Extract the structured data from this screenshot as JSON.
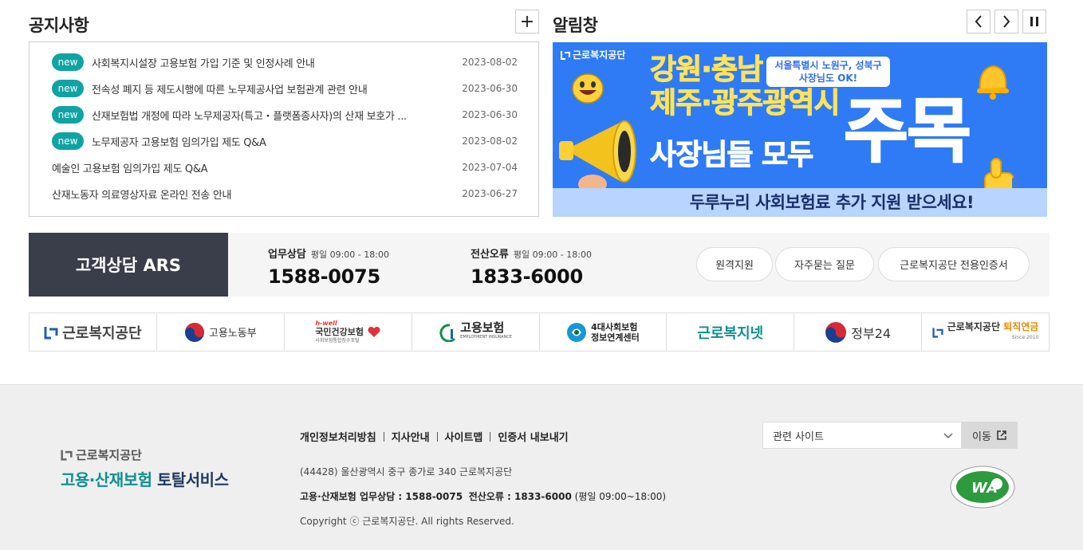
{
  "notice": {
    "title": "공지사항",
    "more_label": "+",
    "items": [
      {
        "badge": "new",
        "text": "사회복지시설장 고용보험 가입 기준 및 인정사례 안내",
        "date": "2023-08-02"
      },
      {
        "badge": "new",
        "text": "전속성 폐지 등 제도시행에 따른 노무제공사업 보험관계 관련 안내",
        "date": "2023-06-30"
      },
      {
        "badge": "new",
        "text": "산재보험법 개정에 따라 노무제공자(특고・플랫폼종사자)의 산재 보호가 ...",
        "date": "2023-06-30"
      },
      {
        "badge": "new",
        "text": "노무제공자 고용보험 임의가입 제도 Q&A",
        "date": "2023-08-02"
      },
      {
        "badge": "",
        "text": "예술인 고용보험 임의가입 제도 Q&A",
        "date": "2023-07-04"
      },
      {
        "badge": "",
        "text": "산재노동자 의료영상자료 온라인 전송 안내",
        "date": "2023-06-27"
      }
    ]
  },
  "alert": {
    "title": "알림창",
    "banner": {
      "logo": "근로복지공단",
      "line1": "강원·충남",
      "line2": "제주·광주광역시",
      "line3": "사장님들 모두",
      "big": "주목",
      "bubble_line1": "서울특별시 노원구, 성북구",
      "bubble_line2": "사장님도 OK!",
      "bottom": "두루누리 사회보험료 추가 지원 받으세요!"
    }
  },
  "ars": {
    "title": "고객상담 ARS",
    "items": [
      {
        "label": "업무상담",
        "hours": "평일 09:00 - 18:00",
        "number": "1588-0075"
      },
      {
        "label": "전산오류",
        "hours": "평일 09:00 - 18:00",
        "number": "1833-6000"
      }
    ],
    "buttons": [
      "원격지원",
      "자주묻는 질문",
      "근로복지공단 전용인증서"
    ]
  },
  "partners": [
    {
      "name": "근로복지공단",
      "icon": "kcomwel-logo-icon"
    },
    {
      "name": "고용노동부",
      "icon": "taegeuk-icon"
    },
    {
      "name": "국민건강보험",
      "sub": "사회보험통합징수포털",
      "tag": "h-well",
      "icon": "heart-icon"
    },
    {
      "name": "고용보험",
      "sub": "EMPLOYMENT INSURANCE",
      "icon": "ei-logo-icon"
    },
    {
      "name": "4대사회보험",
      "sub": "정보연계센터",
      "icon": "4insure-logo-icon"
    },
    {
      "name": "근로복지넷",
      "icon": ""
    },
    {
      "name": "정부24",
      "icon": "taegeuk-icon"
    },
    {
      "name": "근로복지공단",
      "accent": "퇴직연금",
      "sub": "Since 2010",
      "icon": "kcomwel-logo-icon"
    }
  ],
  "footer": {
    "logo_small": "근로복지공단",
    "logo_big_accent": "고용·산재보험",
    "logo_big_rest": "토탈서비스",
    "links": [
      "개인정보처리방침",
      "지사안내",
      "사이트맵",
      "인증서 내보내기"
    ],
    "address": "(44428) 울산광역시 중구 종가로 340 근로복지공단",
    "phone_label1": "고용·산재보험 업무상담 : 1588-0075",
    "phone_label2": "전산오류 : 1833-6000",
    "phone_hours": "(평일 09:00~18:00)",
    "copyright": "Copyright ⓒ 근로복지공단. All rights Reserved.",
    "related_site_select": "관련 사이트",
    "go_button": "이동",
    "wa_label": "WA"
  },
  "colors": {
    "teal_badge": "#10a3a3",
    "banner_blue": "#2f7bf5",
    "banner_yellow": "#ffe35a",
    "ars_dark": "#3a3e4a",
    "footer_bg": "#efefef",
    "brand_blue": "#1d5fb5",
    "brand_teal": "#0f8f8f"
  }
}
